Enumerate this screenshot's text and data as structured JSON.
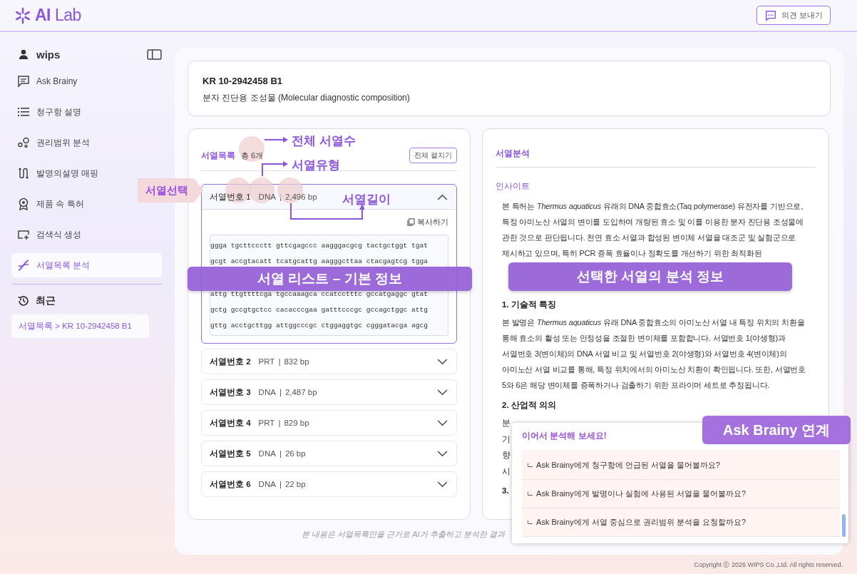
{
  "header": {
    "logo": "**AI** Lab",
    "feedback_button": "의견 보내기"
  },
  "sidebar": {
    "user": "wips",
    "items": [
      {
        "label": "Ask Brainy",
        "kind": "chat",
        "selected": false
      },
      {
        "label": "청구항 설명",
        "kind": "list",
        "selected": false
      },
      {
        "label": "권리범위 분석",
        "kind": "nodes",
        "selected": false
      },
      {
        "label": "발명의설명 매핑",
        "kind": "mapping",
        "selected": false
      },
      {
        "label": "제품 속 특허",
        "kind": "award",
        "selected": false
      },
      {
        "label": "검색식 생성",
        "kind": "query",
        "selected": false
      },
      {
        "label": "서열목록 분석",
        "kind": "dna",
        "selected": true
      }
    ],
    "recent_heading": "최근",
    "recent_items": [
      "서열목록 > KR 10-2942458 B1"
    ]
  },
  "patent": {
    "number": "KR 10-2942458 B1",
    "title": "분자 진단용 조성물 (Molecular diagnostic composition)"
  },
  "sequence_list": {
    "title": "서열목록",
    "count": "총 6개",
    "expand_all_button": "전체 펼치기",
    "copy_button": "복사하기",
    "separator": "|",
    "items": [
      {
        "label": "서열번호 1",
        "type": "DNA",
        "length": "2,496 bp",
        "expanded": true,
        "sequence_lines": [
          "ggga tgcttccctt gttcgagccc aagggacgcg tactgctggt tgat",
          "gcgt accgtacatt tcatgcattg aagggcttaa ctacgagtcg tgga",
          "attg ttgttttcga tgccaaagca ccatcctttc gccatgaggc gtat",
          "gctg gccgtgctcc cacacccgaa gatttcccgc gccagctggc attg",
          "gttg acctgcttgg attggcccgc ctggaggtgc cgggatacga agcg"
        ]
      },
      {
        "label": "서열번호 2",
        "type": "PRT",
        "length": "832 bp",
        "expanded": false
      },
      {
        "label": "서열번호 3",
        "type": "DNA",
        "length": "2,487 bp",
        "expanded": false
      },
      {
        "label": "서열번호 4",
        "type": "PRT",
        "length": "829 bp",
        "expanded": false
      },
      {
        "label": "서열번호 5",
        "type": "DNA",
        "length": "26 bp",
        "expanded": false
      },
      {
        "label": "서열번호 6",
        "type": "DNA",
        "length": "22 bp",
        "expanded": false
      }
    ]
  },
  "analysis": {
    "title": "서열분석",
    "insight_heading": "인사이트",
    "insight_text": "본 특허는 *Thermus aquaticus* 유래의 DNA 중합효소(Taq polymerase) 유전자를 기반으로, 특정 아미노산 서열의 변이를 도입하여 개량된 효소 및 이를 이용한 분자 진단용 조성물에 관한 것으로 판단됩니다. 천연 효소 서열과 합성된 변이체 서열을 대조군 및 실험군으로 제시하고 있으며, 특히 PCR 증폭 효율이나 정확도를 개선하기 위한 최적화된",
    "sections": [
      {
        "heading": "1. 기술적 특징",
        "text": "본 발명은 *Thermus aquaticus* 유래 DNA 중합효소의 아미노산 서열 내 특정 위치의 치환을 통해 효소의 활성 또는 안정성을 조절한 변이체를 포함합니다. 서열번호 1(야생형)과 서열번호 3(변이체)의 DNA 서열 비교 및 서열번호 2(야생형)와 서열번호 4(변이체)의 아미노산 서열 비교를 통해, 특정 위치에서의 아미노산 치환이 확인됩니다. 또한, 서열번호 5와 6은 해당 변이체를 증폭하거나 검출하기 위한 프라이머 세트로 추정됩니다."
      },
      {
        "heading": "2. 산업적 의의",
        "lines": [
          "분",
          "기",
          "향",
          "시"
        ]
      },
      {
        "heading": "3."
      }
    ]
  },
  "footer_note": "본 내용은 서열목록만을 근거로 AI가 추출하고 분석한 결과",
  "copyright": "Copyright ⓒ 2026 WIPS Co.,Ltd. All rights reserved.",
  "ask_brainy_popup": {
    "title": "이어서 분석해 보세요!",
    "suggestions": [
      "ㄴ Ask Brainy에게 청구항에 언급된 서열을 물어볼까요?",
      "ㄴ Ask Brainy에게 발명이나 실험에 사용된 서열을 물어볼까요?",
      "ㄴ Ask Brainy에게 서열 중심으로 권리범위 분석을 요청할까요?"
    ]
  },
  "annotations": {
    "sequence_select": "서열선택",
    "total_count": "전체 서열수",
    "sequence_type": "서열유형",
    "sequence_length": "서열길이",
    "list_banner": "서열 리스트 – 기본 정보",
    "analysis_banner": "선택한 서열의 분석 정보",
    "ask_brainy_label": "Ask Brainy 연계"
  }
}
